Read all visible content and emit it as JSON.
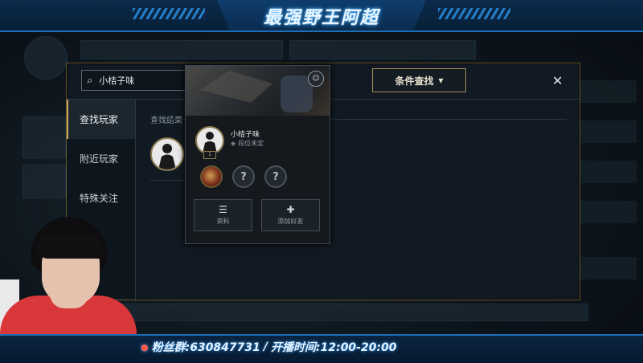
{
  "overlay": {
    "stream_title": "最强野王阿超",
    "fan_id_label": "粉丝群:630847731",
    "separator": "/",
    "broadcast_time": "开播时间:12:00-20:00"
  },
  "modal": {
    "search": {
      "value": "小桔子味",
      "icon": "search-icon"
    },
    "condition_button": "条件查找",
    "close_icon": "close-icon",
    "sidebar": [
      {
        "label": "查找玩家",
        "active": true
      },
      {
        "label": "附近玩家",
        "active": false
      },
      {
        "label": "特殊关注",
        "active": false
      }
    ],
    "results_label": "查找结果"
  },
  "player_card": {
    "name": "小桔子味",
    "rank": "段位未定",
    "level": "1",
    "hero_slots": [
      "hero",
      "?",
      "?"
    ],
    "buttons": [
      {
        "label": "资料",
        "icon": "profile-icon"
      },
      {
        "label": "添加好友",
        "icon": "add-friend-icon"
      }
    ]
  }
}
